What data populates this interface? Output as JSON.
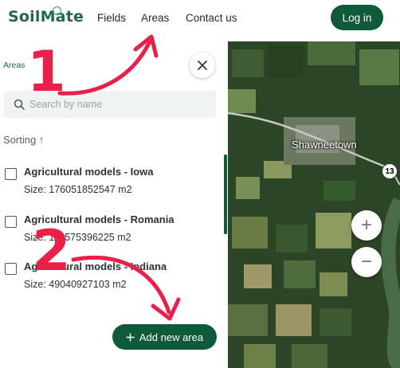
{
  "header": {
    "logo": "SoilMate",
    "nav": [
      "Fields",
      "Areas",
      "Contact us"
    ],
    "login_label": "Log in"
  },
  "sidebar": {
    "breadcrumb": "Areas",
    "search_placeholder": "Search by name",
    "sorting_label": "Sorting ↑",
    "items": [
      {
        "title": "Agricultural models - Iowa",
        "size": "Size: 176051852547 m2"
      },
      {
        "title": "Agricultural models - Romania",
        "size": "Size: 119575396225 m2"
      },
      {
        "title": "Agricultural models - Indiana",
        "size": "Size: 49040927103 m2"
      }
    ],
    "add_label": "Add new area"
  },
  "map": {
    "town_label": "Shawneetown",
    "route_badge": "13",
    "zoom_in": "+",
    "zoom_out": "−"
  },
  "annotations": [
    "1",
    "2"
  ],
  "colors": {
    "brand": "#0f5a39",
    "accent": "#1f6a45",
    "annotation": "#e8204a"
  }
}
